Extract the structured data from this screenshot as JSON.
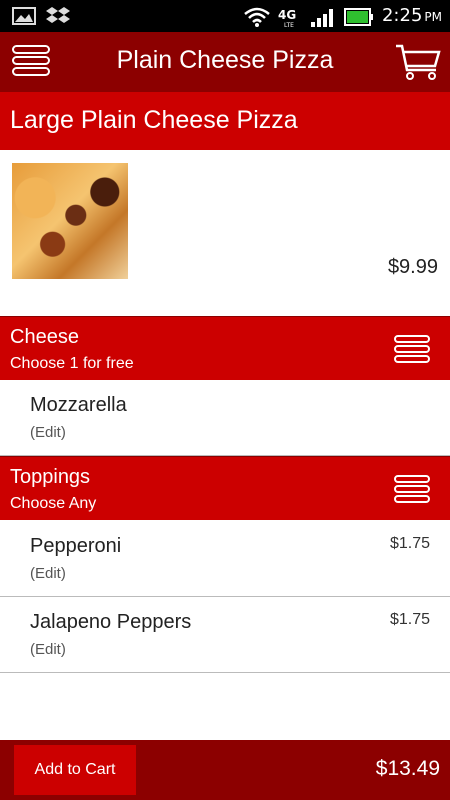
{
  "status_bar": {
    "network": "4G LTE",
    "time": "2:25",
    "ampm": "PM",
    "icons": [
      "gallery-icon",
      "dropbox-icon",
      "wifi-icon",
      "lte-icon",
      "signal-icon",
      "battery-icon"
    ]
  },
  "action_bar": {
    "title": "Plain Cheese Pizza",
    "menu_icon": "hamburger-menu-icon",
    "cart_icon": "shopping-cart-icon"
  },
  "product": {
    "name": "Large Plain Cheese Pizza",
    "price": "$9.99",
    "image_icon": "pizza-photo"
  },
  "sections": [
    {
      "title": "Cheese",
      "subtitle": "Choose 1 for free",
      "options": [
        {
          "name": "Mozzarella",
          "edit": "(Edit)",
          "price": ""
        }
      ]
    },
    {
      "title": "Toppings",
      "subtitle": "Choose Any",
      "options": [
        {
          "name": "Pepperoni",
          "edit": "(Edit)",
          "price": "$1.75"
        },
        {
          "name": "Jalapeno Peppers",
          "edit": "(Edit)",
          "price": "$1.75"
        }
      ]
    }
  ],
  "footer": {
    "add_to_cart_label": "Add to Cart",
    "total": "$13.49"
  },
  "colors": {
    "brand_dark": "#8c0000",
    "brand": "#cc0000",
    "status_bar": "#000000",
    "battery": "#2fbf2f"
  }
}
